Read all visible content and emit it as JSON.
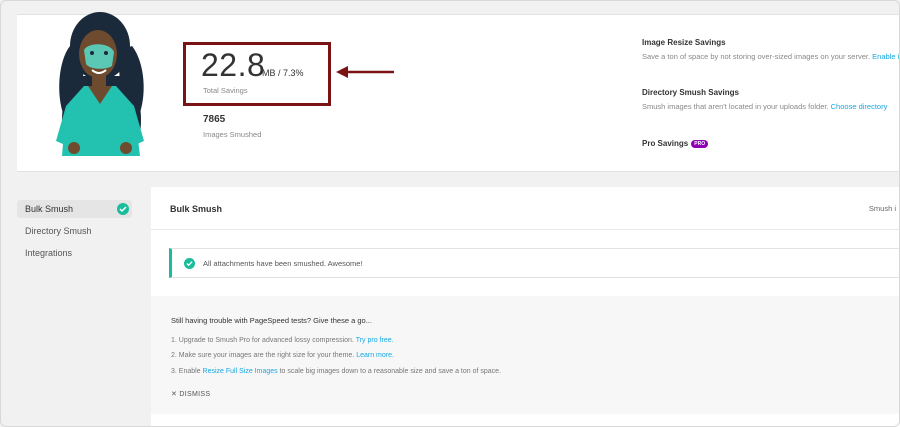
{
  "summary": {
    "total_value": "22.8",
    "total_units": "MB / 7.3%",
    "total_label": "Total Savings",
    "images_count": "7865",
    "images_label": "Images Smushed"
  },
  "savings": {
    "resize": {
      "title": "Image Resize Savings",
      "desc": "Save a ton of space by not storing over-sized images on your server.",
      "link": "Enable i"
    },
    "directory": {
      "title": "Directory Smush Savings",
      "desc": "Smush images that aren't located in your uploads folder.",
      "link": "Choose directory"
    },
    "pro": {
      "title": "Pro Savings",
      "badge": "PRO"
    }
  },
  "sidebar": {
    "items": [
      {
        "label": "Bulk Smush"
      },
      {
        "label": "Directory Smush"
      },
      {
        "label": "Integrations"
      }
    ]
  },
  "main": {
    "title": "Bulk Smush",
    "header_right": "Smush i",
    "notice": "All attachments have been smushed. Awesome!"
  },
  "tips": {
    "title": "Still having trouble with PageSpeed tests? Give these a go...",
    "items": [
      {
        "text": "1. Upgrade to Smush Pro for advanced lossy compression.",
        "link": "Try pro free."
      },
      {
        "text": "2. Make sure your images are the right size for your theme.",
        "link": "Learn more."
      },
      {
        "prefix": "3. Enable",
        "link": "Resize Full Size Images",
        "text": "to scale big images down to a reasonable size and save a ton of space."
      }
    ],
    "dismiss": "DISMISS"
  },
  "colors": {
    "accent_link": "#17a8e3",
    "success": "#1abc9c",
    "highlight_box": "#7a1414",
    "pro_badge": "#8d00b1"
  }
}
